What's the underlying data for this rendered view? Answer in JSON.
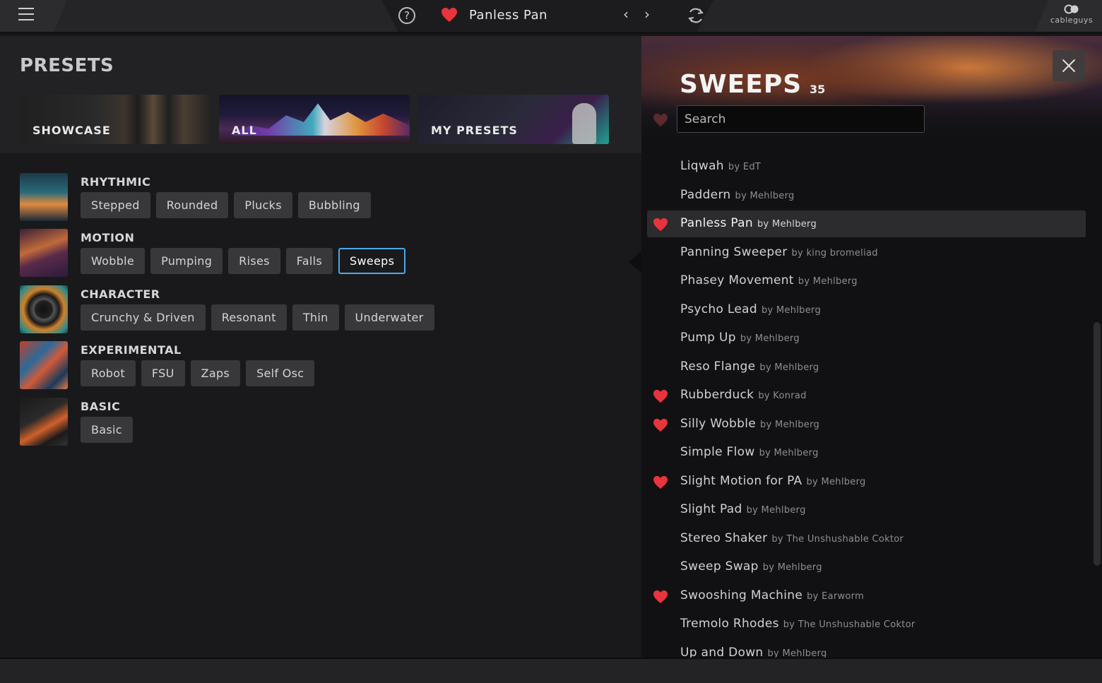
{
  "topbar": {
    "preset_name": "Panless Pan",
    "prev_glyph": "‹",
    "next_glyph": "›",
    "help_glyph": "?",
    "logo_text": "cableguys"
  },
  "left": {
    "title": "PRESETS",
    "cards": [
      {
        "label": "SHOWCASE"
      },
      {
        "label": "ALL"
      },
      {
        "label": "MY PRESETS"
      }
    ],
    "categories": [
      {
        "title": "RHYTHMIC",
        "tags": [
          "Stepped",
          "Rounded",
          "Plucks",
          "Bubbling"
        ]
      },
      {
        "title": "MOTION",
        "tags": [
          "Wobble",
          "Pumping",
          "Rises",
          "Falls",
          "Sweeps"
        ]
      },
      {
        "title": "CHARACTER",
        "tags": [
          "Crunchy & Driven",
          "Resonant",
          "Thin",
          "Underwater"
        ]
      },
      {
        "title": "EXPERIMENTAL",
        "tags": [
          "Robot",
          "FSU",
          "Zaps",
          "Self Osc"
        ]
      },
      {
        "title": "BASIC",
        "tags": [
          "Basic"
        ]
      }
    ],
    "active_tag": "Sweeps"
  },
  "right": {
    "title": "SWEEPS",
    "count": "35",
    "search_placeholder": "Search",
    "presets": [
      {
        "name": "Liqwah",
        "author": "by EdT",
        "fav": false
      },
      {
        "name": "Paddern",
        "author": "by Mehlberg",
        "fav": false
      },
      {
        "name": "Panless Pan",
        "author": "by Mehlberg",
        "fav": true,
        "selected": true
      },
      {
        "name": "Panning Sweeper",
        "author": "by king bromeliad",
        "fav": false
      },
      {
        "name": "Phasey Movement",
        "author": "by Mehlberg",
        "fav": false
      },
      {
        "name": "Psycho Lead",
        "author": "by Mehlberg",
        "fav": false
      },
      {
        "name": "Pump Up",
        "author": "by Mehlberg",
        "fav": false
      },
      {
        "name": "Reso Flange",
        "author": "by Mehlberg",
        "fav": false
      },
      {
        "name": "Rubberduck",
        "author": "by Konrad",
        "fav": true
      },
      {
        "name": "Silly Wobble",
        "author": "by Mehlberg",
        "fav": true
      },
      {
        "name": "Simple Flow",
        "author": "by Mehlberg",
        "fav": false
      },
      {
        "name": "Slight Motion for PA",
        "author": "by Mehlberg",
        "fav": true
      },
      {
        "name": "Slight Pad",
        "author": "by Mehlberg",
        "fav": false
      },
      {
        "name": "Stereo Shaker",
        "author": "by The Unshushable Coktor",
        "fav": false
      },
      {
        "name": "Sweep Swap",
        "author": "by Mehlberg",
        "fav": false
      },
      {
        "name": "Swooshing Machine",
        "author": "by Earworm",
        "fav": true
      },
      {
        "name": "Tremolo Rhodes",
        "author": "by The Unshushable Coktor",
        "fav": false
      },
      {
        "name": "Up and Down",
        "author": "by Mehlberg",
        "fav": false
      }
    ]
  },
  "colors": {
    "accent": "#4aa8e8",
    "heart": "#e8343c"
  }
}
